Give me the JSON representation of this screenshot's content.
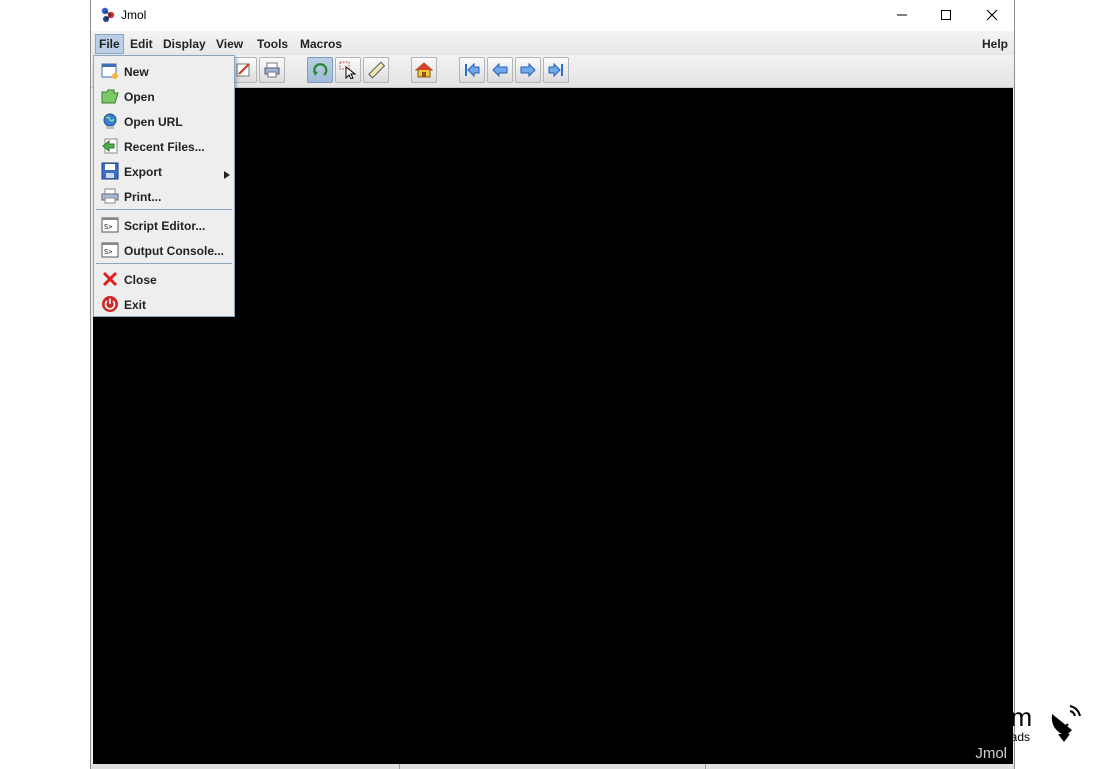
{
  "window": {
    "title": "Jmol"
  },
  "menubar": {
    "items": [
      {
        "label": "File"
      },
      {
        "label": "Edit"
      },
      {
        "label": "Display"
      },
      {
        "label": "View"
      },
      {
        "label": "Tools"
      },
      {
        "label": "Macros"
      }
    ],
    "help": "Help"
  },
  "file_menu": {
    "items": [
      {
        "label": "New",
        "icon": "new-document-icon"
      },
      {
        "label": "Open",
        "icon": "folder-open-icon"
      },
      {
        "label": "Open URL",
        "icon": "globe-icon"
      },
      {
        "label": "Recent Files...",
        "icon": "recent-arrow-icon"
      },
      {
        "label": "Export",
        "icon": "save-disk-icon"
      },
      {
        "label": "Print...",
        "icon": "printer-icon"
      },
      {
        "label": "Script Editor...",
        "icon": "console-icon"
      },
      {
        "label": "Output Console...",
        "icon": "console-icon"
      },
      {
        "label": "Close",
        "icon": "close-x-icon"
      },
      {
        "label": "Exit",
        "icon": "power-icon"
      }
    ]
  },
  "toolbar": {
    "icons": [
      "edit-icon",
      "print-icon",
      "rotate-icon",
      "select-icon",
      "measure-icon",
      "home-icon",
      "first-frame-icon",
      "previous-frame-icon",
      "next-frame-icon",
      "last-frame-icon"
    ]
  },
  "viewer": {
    "watermark": "Jmol"
  },
  "overlay_logo": {
    "big_text": "om",
    "small_text": "oads"
  },
  "colors": {
    "viewer_bg": "#000000",
    "menu_highlight": "#b8cfe5",
    "border_accent": "#8aa6c1"
  }
}
